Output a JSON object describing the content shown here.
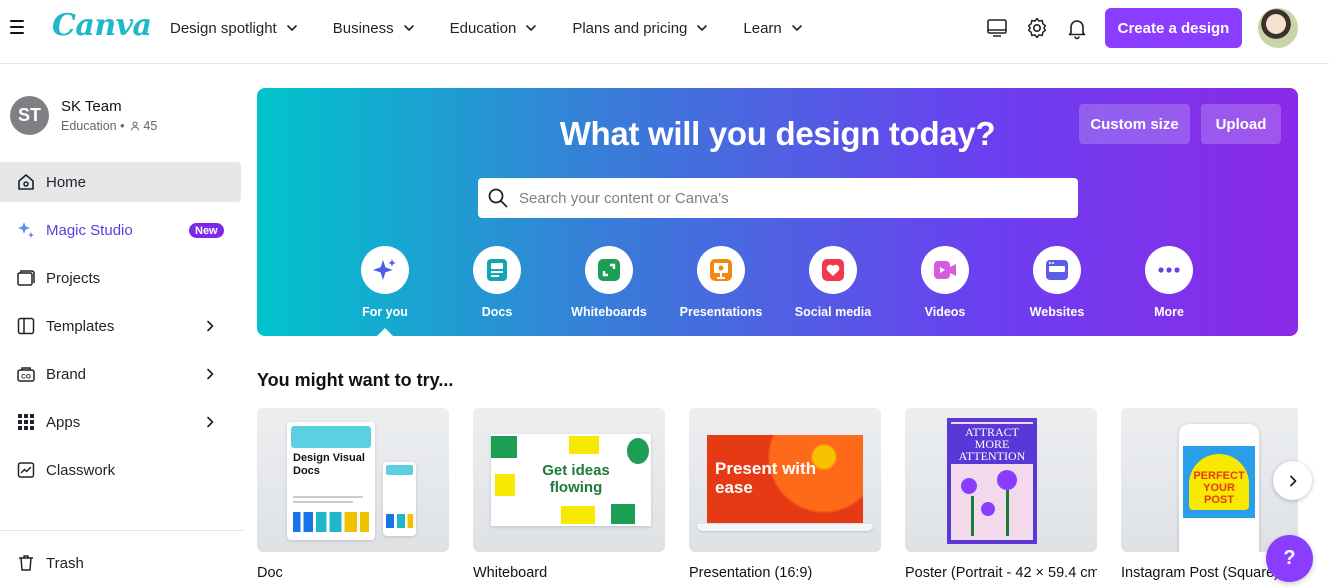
{
  "header": {
    "logo": "Canva",
    "nav": [
      {
        "label": "Design spotlight"
      },
      {
        "label": "Business"
      },
      {
        "label": "Education"
      },
      {
        "label": "Plans and pricing"
      },
      {
        "label": "Learn"
      }
    ],
    "icons": [
      "desktop-icon",
      "gear-icon",
      "bell-icon"
    ],
    "create_label": "Create a design"
  },
  "sidebar": {
    "team": {
      "initials": "ST",
      "name": "SK Team",
      "type": "Education",
      "members": "45"
    },
    "items": [
      {
        "label": "Home",
        "icon": "home-icon",
        "active": true
      },
      {
        "label": "Magic Studio",
        "icon": "sparkle-icon",
        "badge": "New"
      },
      {
        "label": "Projects",
        "icon": "folder-icon"
      },
      {
        "label": "Templates",
        "icon": "templates-icon"
      },
      {
        "label": "Brand",
        "icon": "brand-icon"
      },
      {
        "label": "Apps",
        "icon": "apps-grid-icon"
      },
      {
        "label": "Classwork",
        "icon": "classwork-icon"
      },
      {
        "label": "Trash",
        "icon": "trash-icon"
      }
    ]
  },
  "hero": {
    "title": "What will you design today?",
    "custom_size_label": "Custom size",
    "upload_label": "Upload",
    "search_placeholder": "Search your content or Canva's",
    "categories": [
      {
        "label": "For you",
        "icon": "sparkles-icon",
        "color": "#4a5ce8"
      },
      {
        "label": "Docs",
        "icon": "doc-icon",
        "color": "#13a3b5"
      },
      {
        "label": "Whiteboards",
        "icon": "whiteboard-icon",
        "color": "#1c9e55"
      },
      {
        "label": "Presentations",
        "icon": "presentation-icon",
        "color": "#f08a12"
      },
      {
        "label": "Social media",
        "icon": "heart-icon",
        "color": "#f0384e"
      },
      {
        "label": "Videos",
        "icon": "video-icon",
        "color": "#d65cde"
      },
      {
        "label": "Websites",
        "icon": "website-icon",
        "color": "#5b5ce8"
      },
      {
        "label": "More",
        "icon": "more-dots-icon",
        "color": "#6c3ee8"
      }
    ]
  },
  "suggestions": {
    "title": "You might want to try...",
    "items": [
      {
        "label": "Doc",
        "thumb_text": "Design Visual Docs"
      },
      {
        "label": "Whiteboard",
        "thumb_text": "Get ideas flowing"
      },
      {
        "label": "Presentation (16:9)",
        "thumb_text": "Present with ease"
      },
      {
        "label": "Poster (Portrait - 42 × 59.4 cm)",
        "thumb_text": "ATTRACT MORE ATTENTION"
      },
      {
        "label": "Instagram Post (Square)",
        "thumb_text": "PERFECT YOUR POST"
      }
    ]
  },
  "help_label": "?",
  "colors": {
    "brand_purple": "#8b3dff",
    "logo_teal": "#20b8c9",
    "hero_start": "#00c4cc",
    "hero_end": "#8b2ae8"
  }
}
